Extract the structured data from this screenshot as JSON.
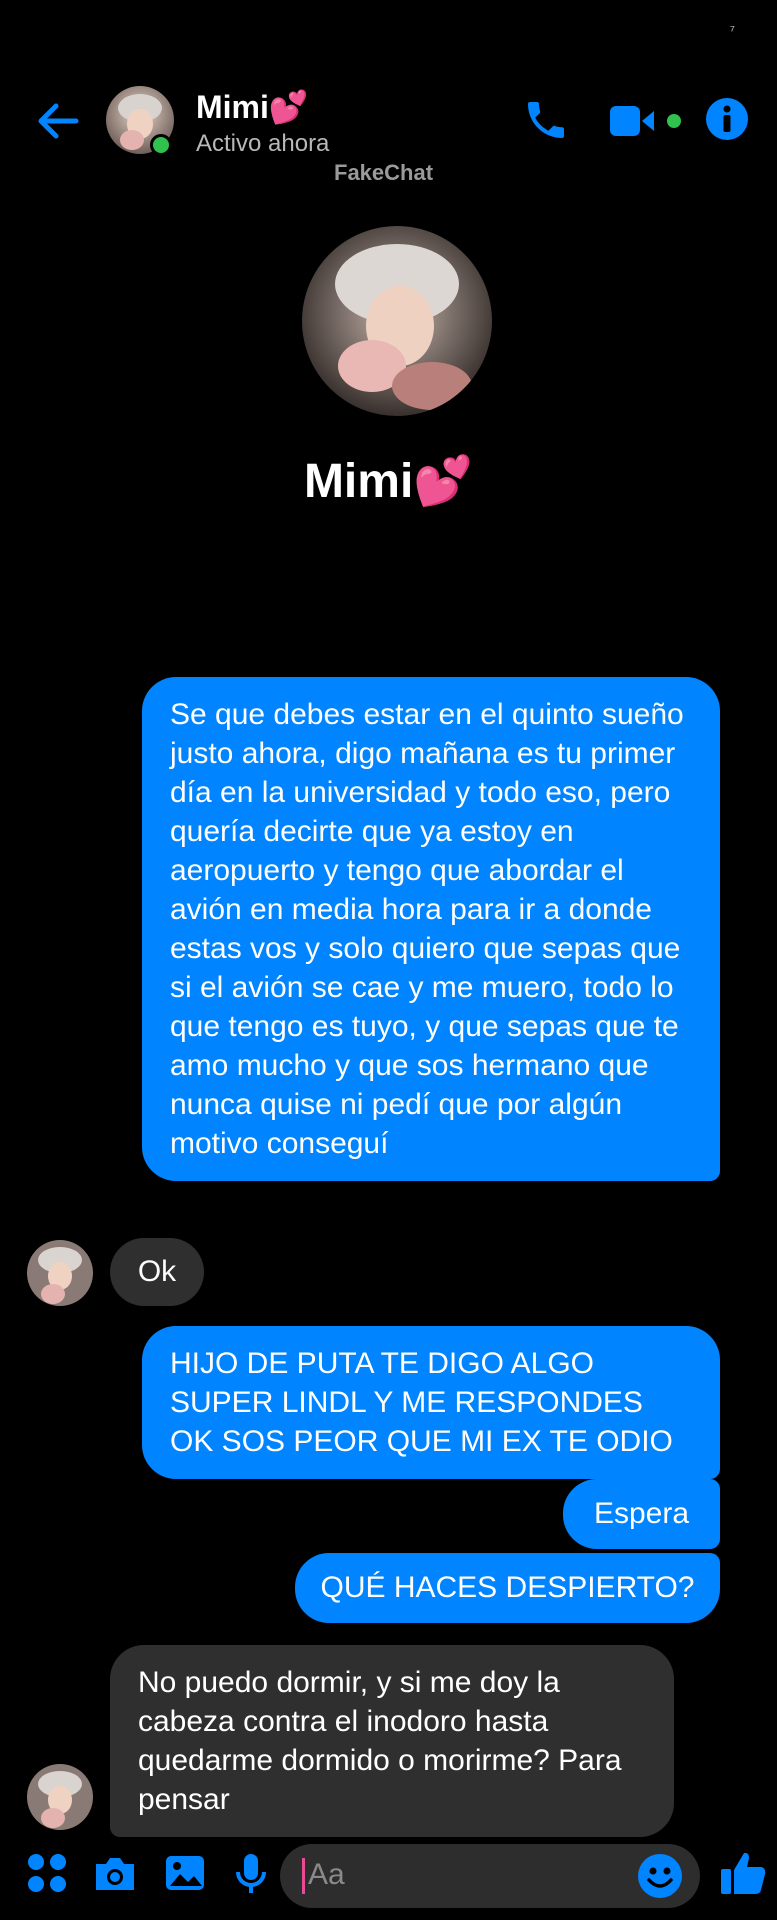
{
  "status_bar": {
    "mark": "⁷"
  },
  "header": {
    "contact_name": "Mimi💕",
    "contact_status": "Activo ahora",
    "watermark": "FakeChat",
    "back_icon": "arrow-left-icon",
    "call_icon": "phone-icon",
    "video_icon": "video-camera-icon",
    "info_icon": "info-icon"
  },
  "profile": {
    "name": "Mimi💕"
  },
  "messages": [
    {
      "side": "outgoing",
      "text": "Se que debes estar en el quinto sueño justo ahora, digo mañana es tu primer día en la universidad y todo eso, pero quería decirte que ya estoy en aeropuerto y tengo que abordar el avión en media hora para ir a donde estas vos y solo quiero que sepas que si el avión se cae y me muero, todo lo que tengo es tuyo, y que sepas que te amo mucho y que sos hermano que nunca quise ni pedí que por algún motivo conseguí"
    },
    {
      "side": "incoming",
      "text": "Ok"
    },
    {
      "side": "outgoing",
      "text": "HIJO DE PUTA TE DIGO ALGO SUPER LINDL Y ME RESPONDES OK SOS PEOR QUE MI EX TE ODIO"
    },
    {
      "side": "outgoing",
      "text": "Espera"
    },
    {
      "side": "outgoing",
      "text": "QUÉ HACES DESPIERTO?"
    },
    {
      "side": "incoming",
      "text": "No puedo dormir, y si me doy la cabeza contra el inodoro hasta quedarme dormido o morirme? Para pensar"
    }
  ],
  "composer": {
    "placeholder": "Aa",
    "icons": [
      "apps-icon",
      "camera-icon",
      "image-icon",
      "microphone-icon",
      "emoji-icon",
      "thumbs-up-icon"
    ]
  },
  "colors": {
    "accent": "#0084ff",
    "incoming_bubble": "#2f2f2f",
    "online": "#31c24d",
    "background": "#000000"
  }
}
